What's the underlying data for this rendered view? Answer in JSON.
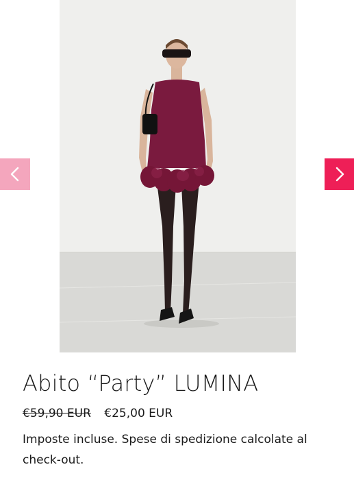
{
  "gallery": {
    "prev_icon": "chevron-left-icon",
    "next_icon": "chevron-right-icon",
    "prev_color": "#f4a6bd",
    "next_color": "#ee1f57",
    "image_alt": "Abito Party LUMINA"
  },
  "product": {
    "title": "Abito “Party” LUMINA",
    "price_old": "€59,90 EUR",
    "price_new": "€25,00 EUR",
    "tax_text": "Imposte incluse.",
    "shipping_link": "Spese di spedizione",
    "shipping_tail": " calcolate al check-out."
  },
  "colors": {
    "dress": "#7a1a3e",
    "accent": "#ee1f57"
  }
}
